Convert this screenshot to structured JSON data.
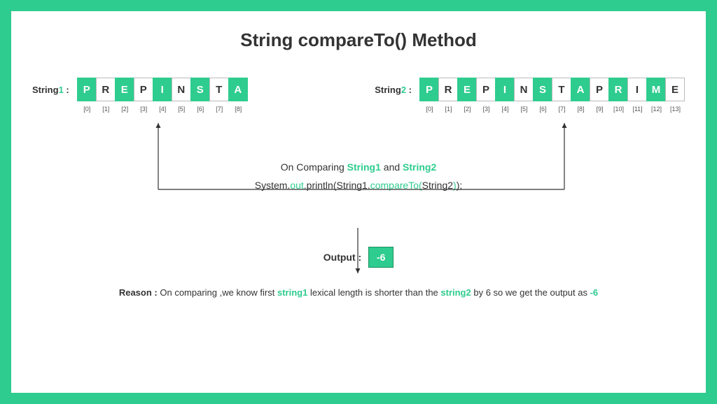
{
  "title": "String compareTo() Method",
  "string1": {
    "label_prefix": "String",
    "label_num": "1",
    "label_suffix": " :",
    "chars": [
      "P",
      "R",
      "E",
      "P",
      "I",
      "N",
      "S",
      "T",
      "A"
    ]
  },
  "string2": {
    "label_prefix": "String",
    "label_num": "2",
    "label_suffix": " :",
    "chars": [
      "P",
      "R",
      "E",
      "P",
      "I",
      "N",
      "S",
      "T",
      "A",
      "P",
      "R",
      "I",
      "M",
      "E"
    ]
  },
  "compare": {
    "prefix": "On Comparing  ",
    "s1": "String1",
    "mid": " and  ",
    "s2": "String2"
  },
  "code": {
    "p1": "System.",
    "p2": "out",
    "p3": ".println(String1.",
    "p4": "compareTo(",
    "p5": "String2",
    "p6": ")",
    "p7": ");"
  },
  "output": {
    "label": "Output :",
    "value": "-6"
  },
  "reason": {
    "label": "Reason :",
    "t1": "  On comparing ,we know first ",
    "s1": "string1",
    "t2": "  lexical length is shorter than the ",
    "s2": "string2",
    "t3": "  by 6  so we get the output as ",
    "val": "-6"
  }
}
